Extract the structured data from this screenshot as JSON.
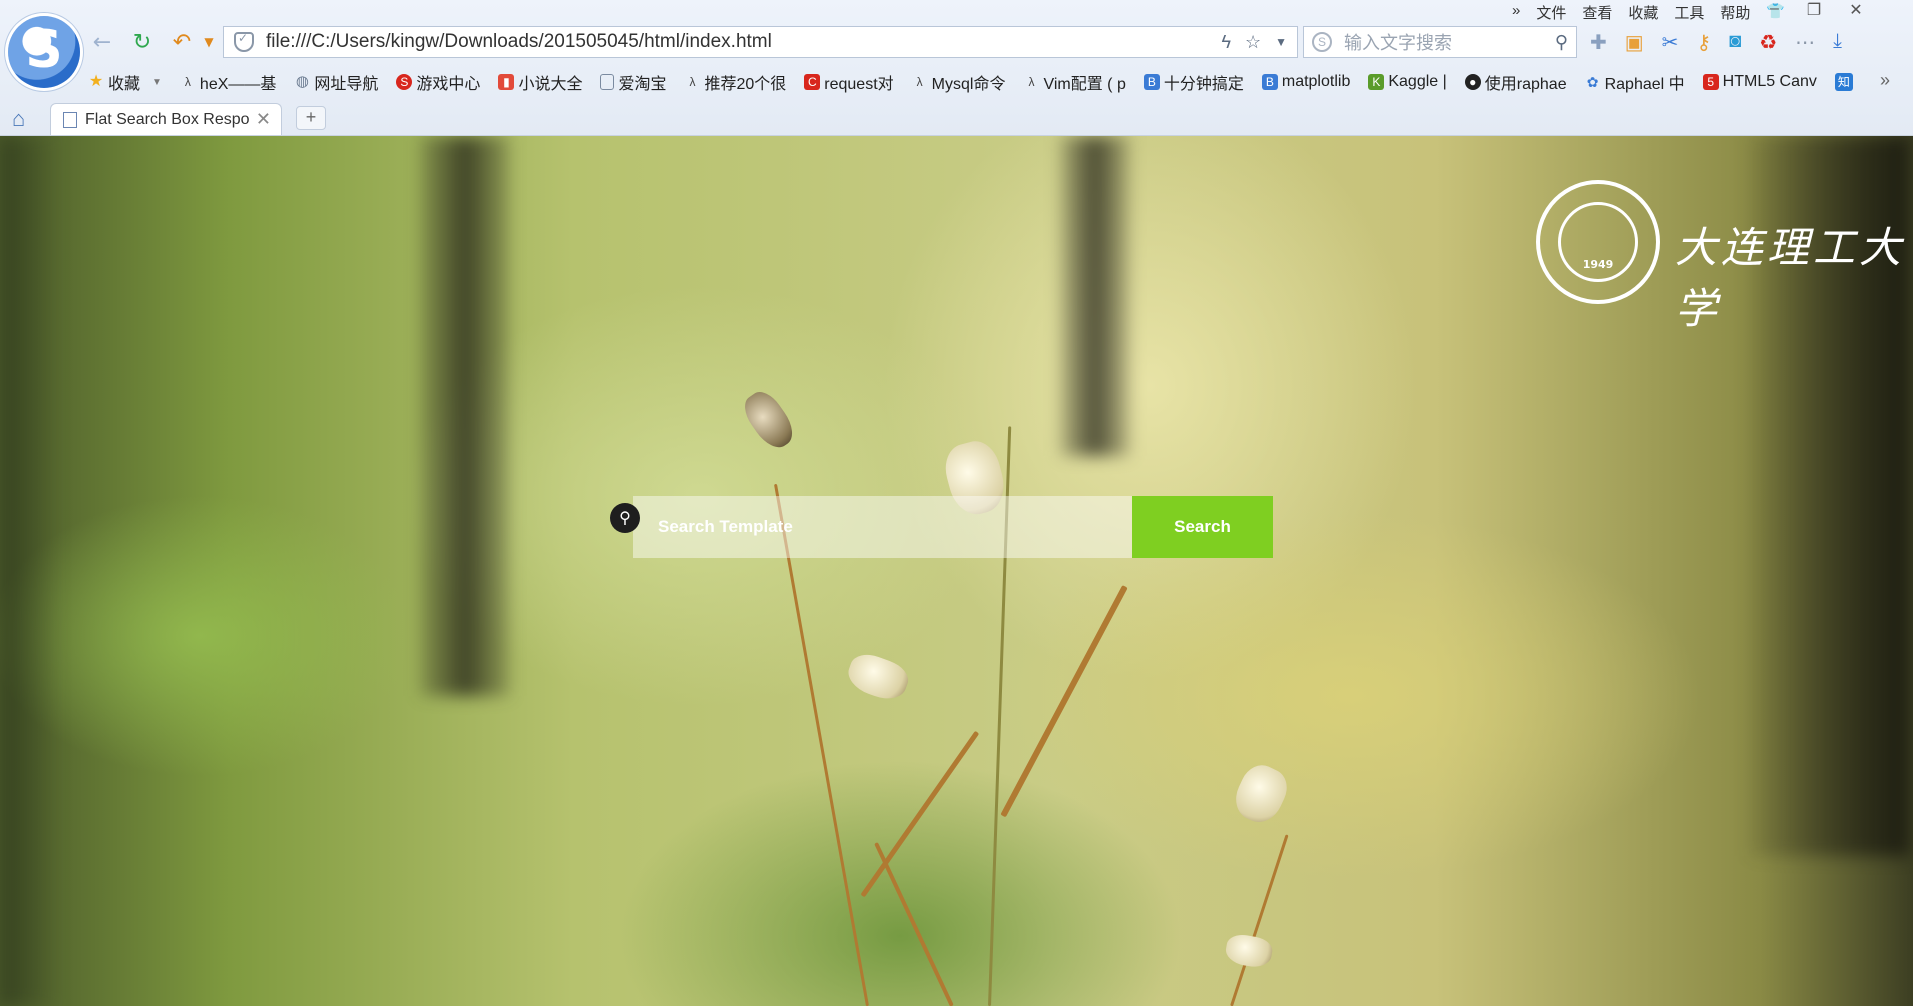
{
  "browser": {
    "address_url": "file:///C:/Users/kingw/Downloads/201505045/html/index.html",
    "search_placeholder": "输入文字搜索",
    "menu": [
      "文件",
      "查看",
      "收藏",
      "工具",
      "帮助"
    ],
    "bookmarks": [
      {
        "label": "收藏",
        "icon": "star-icon",
        "color": "#f2b01e"
      },
      {
        "label": "heX——基",
        "icon": "lambda-icon",
        "color": "#444444"
      },
      {
        "label": "网址导航",
        "icon": "globe-icon",
        "color": "#6b7b90"
      },
      {
        "label": "游戏中心",
        "icon": "game-icon",
        "color": "#d8261d"
      },
      {
        "label": "小说大全",
        "icon": "book-icon",
        "color": "#e24a3a"
      },
      {
        "label": "爱淘宝",
        "icon": "page-icon",
        "color": "#7a8aa0"
      },
      {
        "label": "推荐20个很",
        "icon": "lambda-icon",
        "color": "#444444"
      },
      {
        "label": "request对",
        "icon": "c-icon",
        "color": "#d8261d"
      },
      {
        "label": "Mysql命令",
        "icon": "lambda-icon",
        "color": "#444444"
      },
      {
        "label": "Vim配置 ( p",
        "icon": "lambda-icon",
        "color": "#444444"
      },
      {
        "label": "十分钟搞定",
        "icon": "b-icon",
        "color": "#3a7bd5"
      },
      {
        "label": "matplotlib",
        "icon": "b-icon",
        "color": "#3a7bd5"
      },
      {
        "label": "Kaggle |",
        "icon": "k-icon",
        "color": "#5a9c2a"
      },
      {
        "label": "使用raphae",
        "icon": "github-icon",
        "color": "#222222"
      },
      {
        "label": "Raphael 中",
        "icon": "paw-icon",
        "color": "#3a7bd5"
      },
      {
        "label": "HTML5 Canv",
        "icon": "html5-icon",
        "color": "#d8261d"
      },
      {
        "label": "知",
        "icon": "zhihu-icon",
        "color": "#2a7bd5"
      }
    ],
    "tab_title": "Flat Search Box Respo",
    "new_tab_label": "+"
  },
  "page": {
    "university_year": "1949",
    "university_name": "大连理工大学",
    "search": {
      "placeholder": "Search Template",
      "button_label": "Search",
      "accent_color": "#7fcf21"
    }
  }
}
